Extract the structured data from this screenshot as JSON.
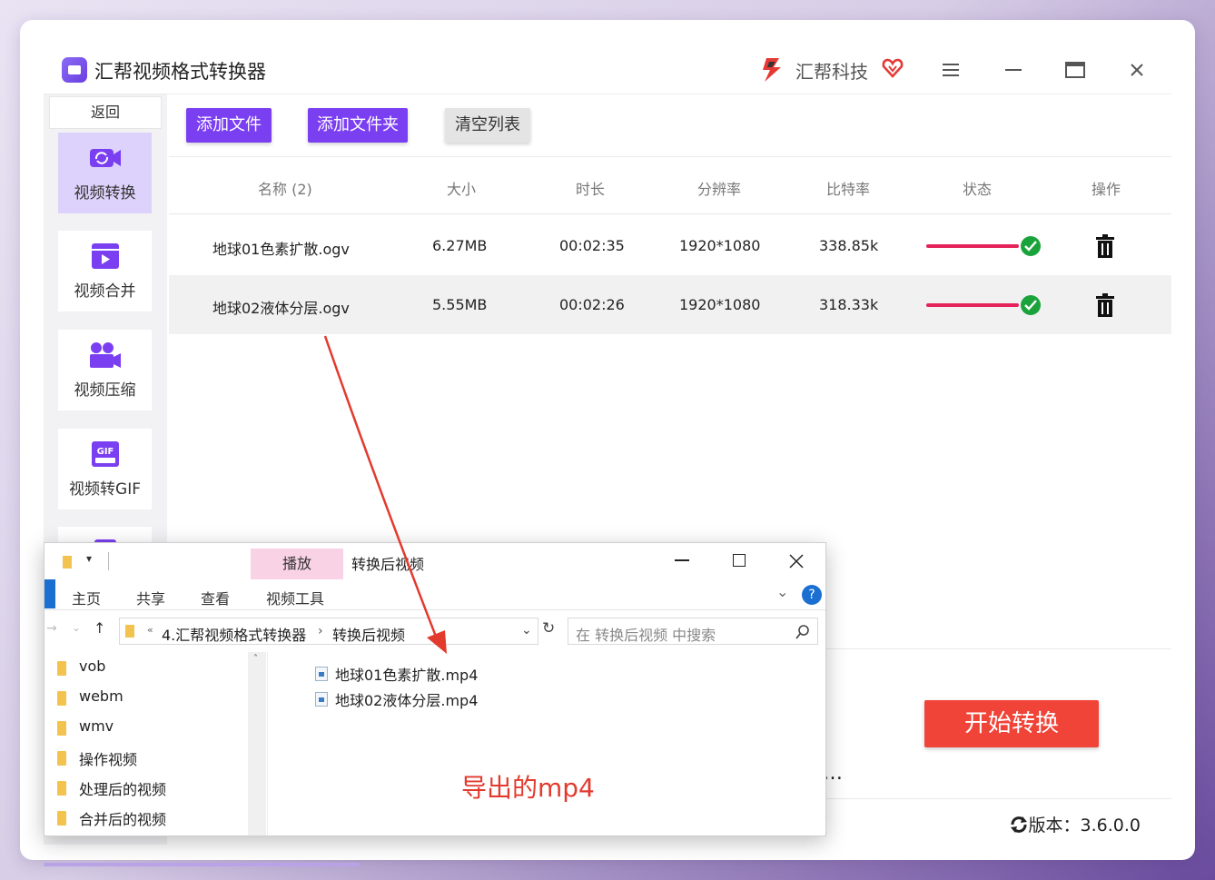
{
  "app": {
    "title": "汇帮视频格式转换器",
    "brand": "汇帮科技",
    "version_label": "版本：3.6.0.0",
    "colors": {
      "accent": "#7b3ff2",
      "start": "#f04438",
      "progress": "#e4235a",
      "ok": "#1aa33b"
    }
  },
  "sidebar": {
    "back": "返回",
    "items": [
      {
        "label": "视频转换",
        "icon": "video-convert-icon",
        "active": true
      },
      {
        "label": "视频合并",
        "icon": "video-merge-icon",
        "active": false
      },
      {
        "label": "视频压缩",
        "icon": "video-compress-icon",
        "active": false
      },
      {
        "label": "视频转GIF",
        "icon": "gif-icon",
        "active": false
      }
    ]
  },
  "toolbar": {
    "add_file": "添加文件",
    "add_folder": "添加文件夹",
    "clear_list": "清空列表"
  },
  "table": {
    "headers": [
      "名称 (2)",
      "大小",
      "时长",
      "分辨率",
      "比特率",
      "状态",
      "操作"
    ],
    "rows": [
      {
        "name": "地球01色素扩散.ogv",
        "size": "6.27MB",
        "duration": "00:02:35",
        "resolution": "1920*1080",
        "bitrate": "338.85k",
        "progress": 1.0
      },
      {
        "name": "地球02液体分层.ogv",
        "size": "5.55MB",
        "duration": "00:02:26",
        "resolution": "1920*1080",
        "bitrate": "318.33k",
        "progress": 1.0
      }
    ]
  },
  "actions": {
    "start": "开始转换",
    "more": "…"
  },
  "explorer": {
    "title": "转换后视频",
    "play_tab": "播放",
    "ribbon_tabs": [
      "主页",
      "共享",
      "查看",
      "视频工具"
    ],
    "breadcrumb": [
      "4.汇帮视频格式转换器",
      "转换后视频"
    ],
    "search_placeholder": "在 转换后视频 中搜索",
    "folders": [
      "vob",
      "webm",
      "wmv",
      "操作视频",
      "处理后的视频",
      "合并后的视频"
    ],
    "files": [
      "地球01色素扩散.mp4",
      "地球02液体分层.mp4"
    ]
  },
  "annotation": "导出的mp4"
}
